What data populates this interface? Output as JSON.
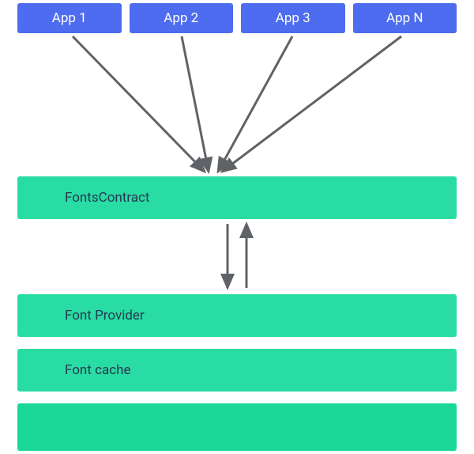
{
  "diagram": {
    "apps": [
      "App 1",
      "App 2",
      "App 3",
      "App N"
    ],
    "layers": {
      "fontsContract": "FontsContract",
      "fontProvider": "Font Provider",
      "fontCache": "Font cache"
    },
    "colors": {
      "app": "#4e6cef",
      "layer": "#29dca3",
      "base": "#1bd898",
      "arrow": "#5f6367"
    },
    "arrows": {
      "appsToContract": [
        {
          "from": "App 1",
          "to": "FontsContract"
        },
        {
          "from": "App 2",
          "to": "FontsContract"
        },
        {
          "from": "App 3",
          "to": "FontsContract"
        },
        {
          "from": "App N",
          "to": "FontsContract"
        }
      ],
      "contractToProvider": {
        "from": "FontsContract",
        "to": "Font Provider",
        "bidirectional": true
      }
    }
  }
}
